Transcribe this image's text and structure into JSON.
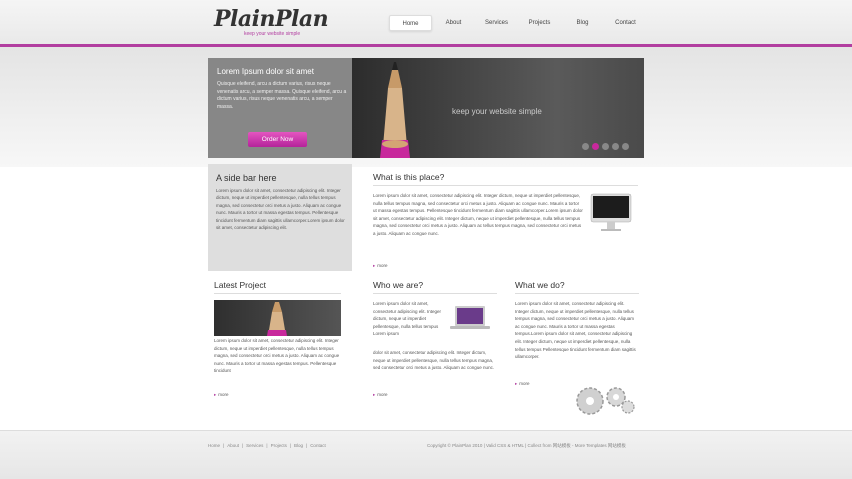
{
  "brand": {
    "logo": "PlainPlan",
    "tagline": "keep your website simple",
    "accent": "#b23ea0"
  },
  "nav": {
    "items": [
      "Home",
      "About",
      "Services",
      "Projects",
      "Blog",
      "Contact"
    ],
    "active": "Home"
  },
  "hero": {
    "title": "Lorem Ipsum dolor sit amet",
    "text": "Quisque eleifend, arcu a dictum varius, risus neque venenatis arcu, a semper massa. Quisque eleifend, arcu a dictum varius, risus neque venenatis arcu, a semper massa.",
    "button": "Order Now",
    "slogan": "keep your website simple",
    "slides": 5,
    "active_slide": 2
  },
  "sidebar": {
    "title": "A side bar here",
    "text": "Lorem ipsum dolor sit amet, consectetur adipiscing elit. Integer dictum, neque ut imperdiet pellentesque, nulla tellus tempus magna, sed consectetur orci metus a justo. Aliquam ac congue nunc. Mauris a tortor ut massa egestas tempus. Pellentesque tincidunt fermentum diam sagittis ullamcorper.Lorem ipsum dolor sit amet, consectetur adipiscing elit."
  },
  "about": {
    "title": "What is this place?",
    "text": "Lorem ipsum dolor sit amet, consectetur adipiscing elit. Integer dictum, neque ut imperdiet pellentesque, nulla tellus tempus magna, sed consectetur orci metus a justo. Aliquam ac congue nunc. Mauris a tortor ut massa egestas tempus. Pellentesque tincidunt fermentum diam sagittis ullamcorper.Lorem ipsum dolor sit amet, consectetur adipiscing elit. Integer dictum, neque ut imperdiet pellentesque, nulla tellus tempus magna, sed consectetur orci metus a justo. Aliquam ac tellus tempus magna, sed consectetur orci metus a justo. Aliquam ac congue nunc.",
    "more": "more"
  },
  "latest": {
    "title": "Latest Project",
    "text": "Lorem ipsum dolor sit amet, consectetur adipiscing elit. Integer dictum, neque ut imperdiet pellentesque, nulla tellus tempus magna, sed consectetur orci metus a justo. Aliquam ac congue nunc. Mauris a tortor ut massa egestas tempus. Pellentesque tincidunt",
    "more": "more"
  },
  "who": {
    "title": "Who we are?",
    "text_narrow": "Lorem ipsum dolor sit amet, consectetur adipiscing elit. Integer dictum, neque ut imperdiet pellentesque, nulla tellus tempus Lorem ipsum",
    "text_wide": "dolor sit amet, consectetur adipiscing elit. Integer dictum, neque ut imperdiet pellentesque, nulla tellus tempus magna, sed consectetur orci metus a justo. Aliquam ac congue nunc.",
    "more": "more"
  },
  "what": {
    "title": "What we do?",
    "text": "Lorem ipsum dolor sit amet, consectetur adipiscing elit. Integer dictum, neque ut imperdiet pellentesque, nulla tellus tempus magna, sed consectetur orci metus a justo. Aliquam ac congue nunc. Mauris a tortor ut massa egestas tempus.Lorem ipsum dolor sit amet, consectetur adipiscing elit. Integer dictum, neque ut imperdiet pellentesque, nulla tellus tempus Pellentesque tincidunt fermentum diam sagittis ullamcorper.",
    "more": "more"
  },
  "footer": {
    "links": [
      "Home",
      "About",
      "Services",
      "Projects",
      "Blog",
      "Contact"
    ],
    "separator": "|",
    "copyright": "Copyright © PlainPlan 2010 | Valid CSS & HTML | Collect from 网站模板 - More Templates 网站模板"
  }
}
